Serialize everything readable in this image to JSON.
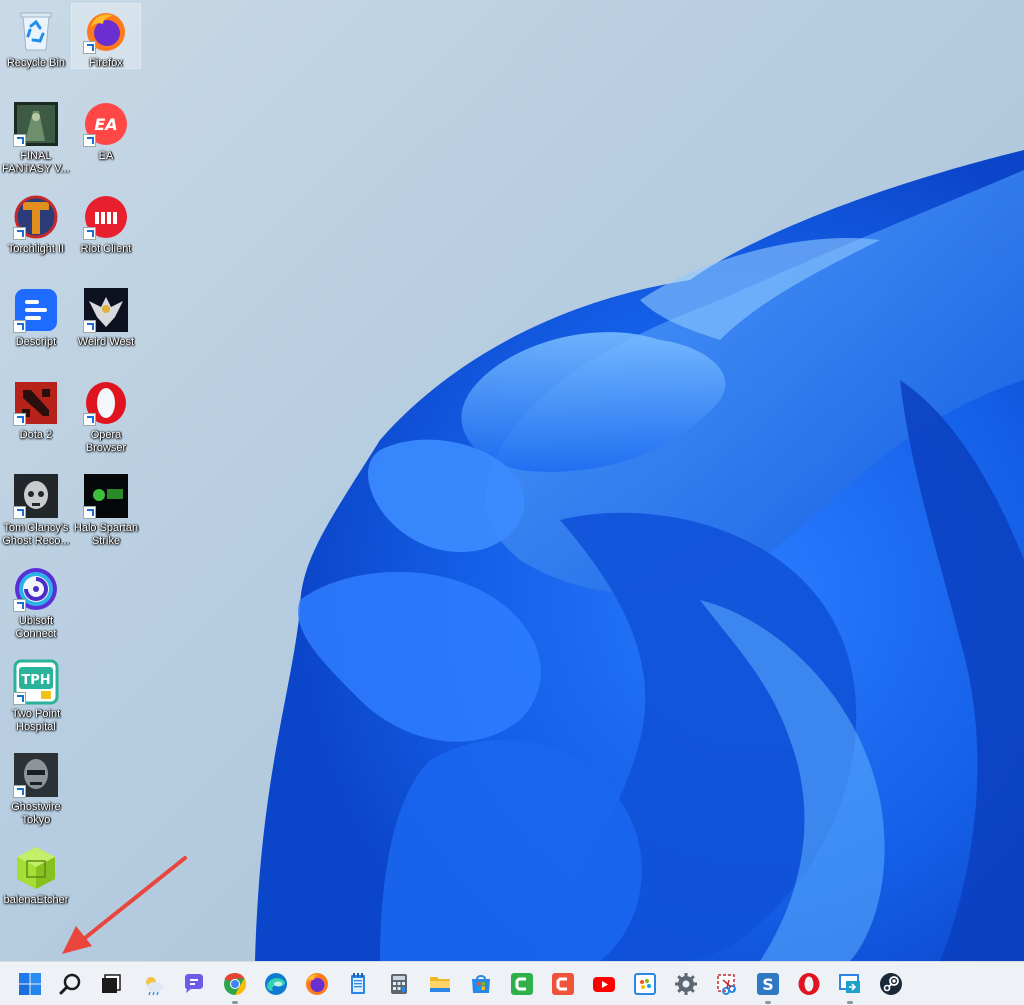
{
  "desktop": {
    "icons": [
      {
        "name": "recycle-bin",
        "label": "Recycle Bin",
        "icon": "recycle-bin-icon",
        "shortcut": false,
        "selected": false
      },
      {
        "name": "firefox",
        "label": "Firefox",
        "icon": "firefox-icon",
        "shortcut": true,
        "selected": true
      },
      {
        "name": "final-fantasy",
        "label": "FINAL\nFANTASY V...",
        "icon": "final-fantasy-icon",
        "shortcut": true,
        "selected": false
      },
      {
        "name": "ea",
        "label": "EA",
        "icon": "ea-icon",
        "shortcut": true,
        "selected": false
      },
      {
        "name": "torchlight",
        "label": "Torchlight II",
        "icon": "torchlight-icon",
        "shortcut": true,
        "selected": false
      },
      {
        "name": "riot-client",
        "label": "Riot Client",
        "icon": "riot-client-icon",
        "shortcut": true,
        "selected": false
      },
      {
        "name": "descript",
        "label": "Descript",
        "icon": "descript-icon",
        "shortcut": true,
        "selected": false
      },
      {
        "name": "weird-west",
        "label": "Weird West",
        "icon": "weird-west-icon",
        "shortcut": true,
        "selected": false
      },
      {
        "name": "dota2",
        "label": "Dota 2",
        "icon": "dota2-icon",
        "shortcut": true,
        "selected": false
      },
      {
        "name": "opera",
        "label": "Opera\nBrowser",
        "icon": "opera-icon",
        "shortcut": true,
        "selected": false
      },
      {
        "name": "ghost-recon",
        "label": "Tom Clancy's\nGhost Reco...",
        "icon": "ghost-recon-icon",
        "shortcut": true,
        "selected": false
      },
      {
        "name": "halo-spartan",
        "label": "Halo Spartan\nStrike",
        "icon": "halo-spartan-icon",
        "shortcut": true,
        "selected": false
      },
      {
        "name": "ubisoft",
        "label": "Ubisoft\nConnect",
        "icon": "ubisoft-icon",
        "shortcut": true,
        "selected": false
      },
      {
        "name": "two-point",
        "label": "Two Point\nHospital",
        "icon": "two-point-hospital-icon",
        "shortcut": true,
        "selected": false
      },
      {
        "name": "ghostwire",
        "label": "Ghostwire\nTokyo",
        "icon": "ghostwire-icon",
        "shortcut": true,
        "selected": false
      },
      {
        "name": "balena",
        "label": "balenaEtcher",
        "icon": "balena-etcher-icon",
        "shortcut": false,
        "selected": false
      }
    ]
  },
  "taskbar": {
    "items": [
      {
        "name": "start",
        "icon": "windows-start-icon",
        "running": false
      },
      {
        "name": "search",
        "icon": "search-icon",
        "running": false
      },
      {
        "name": "task-view",
        "icon": "task-view-icon",
        "running": false
      },
      {
        "name": "widgets",
        "icon": "weather-widget-icon",
        "running": false
      },
      {
        "name": "chat",
        "icon": "teams-chat-icon",
        "running": false
      },
      {
        "name": "chrome",
        "icon": "chrome-icon",
        "running": true
      },
      {
        "name": "edge",
        "icon": "edge-icon",
        "running": false
      },
      {
        "name": "firefox",
        "icon": "firefox-icon",
        "running": false
      },
      {
        "name": "notepad",
        "icon": "notepad-icon",
        "running": false
      },
      {
        "name": "calculator",
        "icon": "calculator-icon",
        "running": false
      },
      {
        "name": "file-explorer",
        "icon": "file-explorer-icon",
        "running": false
      },
      {
        "name": "store",
        "icon": "microsoft-store-icon",
        "running": false
      },
      {
        "name": "camtasia",
        "icon": "camtasia-icon",
        "running": false
      },
      {
        "name": "camtasia-recorder",
        "icon": "camtasia-recorder-icon",
        "running": false
      },
      {
        "name": "youtube",
        "icon": "youtube-icon",
        "running": false
      },
      {
        "name": "paint",
        "icon": "paint-icon",
        "running": false
      },
      {
        "name": "settings",
        "icon": "settings-gear-icon",
        "running": false
      },
      {
        "name": "snipping",
        "icon": "snipping-tool-icon",
        "running": false
      },
      {
        "name": "snagit",
        "icon": "snagit-icon",
        "running": true
      },
      {
        "name": "opera",
        "icon": "opera-icon",
        "running": false
      },
      {
        "name": "remote-desktop",
        "icon": "remote-desktop-icon",
        "running": true
      },
      {
        "name": "steam",
        "icon": "steam-icon",
        "running": false
      }
    ]
  },
  "colors": {
    "annotation_arrow": "#e8453c",
    "taskbar_bg": "#eef2f6",
    "wallpaper_blue": "#1a6cf0"
  }
}
